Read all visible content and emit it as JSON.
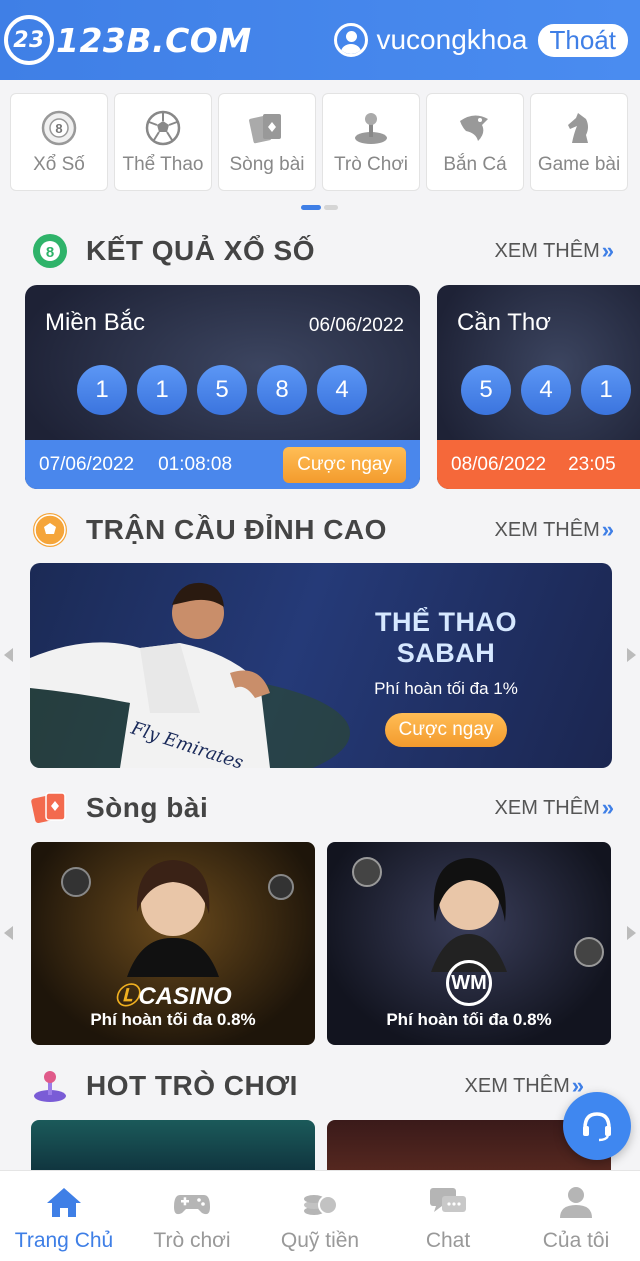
{
  "header": {
    "logo_mark": "23",
    "logo_text": "123B.COM",
    "username": "vucongkhoa",
    "logout_label": "Thoát"
  },
  "categories": [
    {
      "label": "Xổ Số",
      "icon": "lottery-ball-icon"
    },
    {
      "label": "Thể Thao",
      "icon": "soccer-ball-icon"
    },
    {
      "label": "Sòng bài",
      "icon": "cards-icon"
    },
    {
      "label": "Trò Chơi",
      "icon": "joystick-icon"
    },
    {
      "label": "Bắn Cá",
      "icon": "fish-icon"
    },
    {
      "label": "Game bài",
      "icon": "chess-knight-icon"
    }
  ],
  "sections": {
    "lottery": {
      "title": "KẾT QUẢ XỔ SỐ",
      "more": "XEM THÊM",
      "icon_text": "8"
    },
    "sports": {
      "title": "TRẬN CẦU ĐỈNH CAO",
      "more": "XEM THÊM"
    },
    "casino": {
      "title": "Sòng bài",
      "more": "XEM THÊM"
    },
    "games": {
      "title": "HOT TRÒ CHƠI",
      "more": "XEM THÊM"
    }
  },
  "lottery_cards": [
    {
      "region": "Miền Bắc",
      "date": "06/06/2022",
      "numbers": [
        "1",
        "1",
        "5",
        "8",
        "4"
      ],
      "next_date": "07/06/2022",
      "next_time": "01:08:08",
      "bet_label": "Cược ngay",
      "bar_color": "#4a87ec"
    },
    {
      "region": "Cần Thơ",
      "numbers": [
        "5",
        "4",
        "1"
      ],
      "next_date": "08/06/2022",
      "next_time": "23:05",
      "bar_color": "#f5683a"
    }
  ],
  "sports_banner": {
    "title": "THỂ THAO SABAH",
    "subtitle": "Phí hoàn tối đa 1%",
    "button": "Cược ngay",
    "jersey_text": "Fly Emirates"
  },
  "casino_cards": [
    {
      "brand": "CASINO",
      "subtitle": "Phí hoàn tối đa 0.8%"
    },
    {
      "brand": "WM",
      "subtitle": "Phí hoàn tối đa 0.8%"
    }
  ],
  "bottom_nav": [
    {
      "label": "Trang Chủ",
      "icon": "home-icon",
      "active": true
    },
    {
      "label": "Trò chơi",
      "icon": "gamepad-icon",
      "active": false
    },
    {
      "label": "Quỹ tiền",
      "icon": "coins-icon",
      "active": false
    },
    {
      "label": "Chat",
      "icon": "chat-icon",
      "active": false
    },
    {
      "label": "Của tôi",
      "icon": "user-icon",
      "active": false
    }
  ],
  "colors": {
    "primary": "#3f7fe6",
    "accent_orange": "#f39b2d",
    "lotto_bar_blue": "#4a87ec",
    "lotto_bar_orange": "#f5683a"
  }
}
